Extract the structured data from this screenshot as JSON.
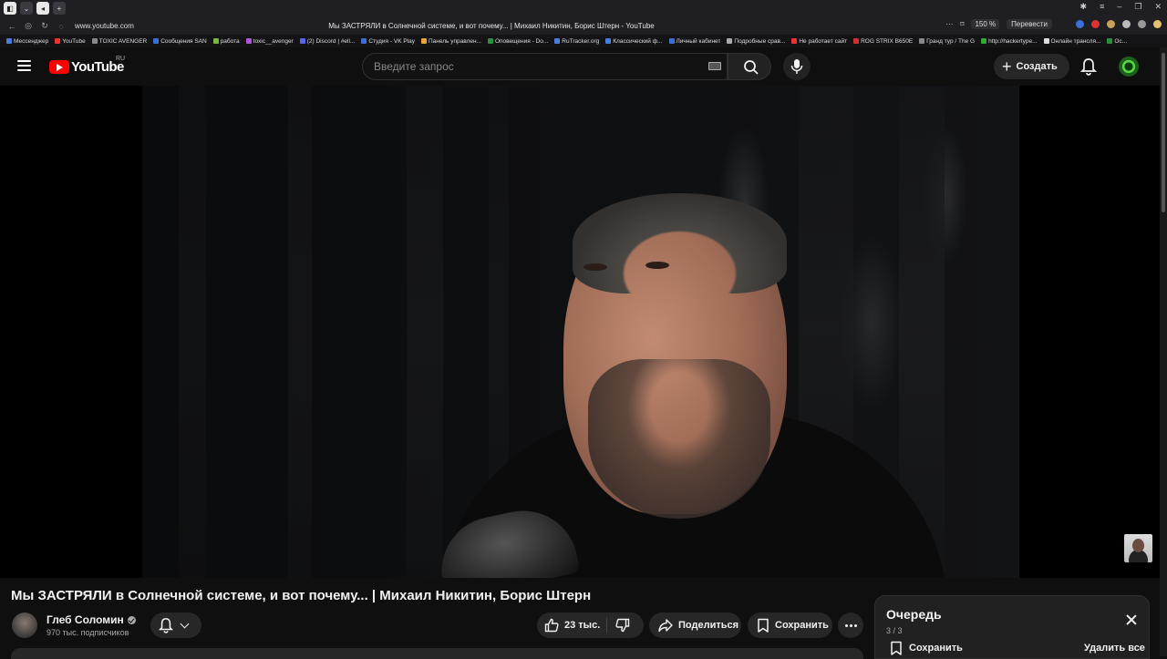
{
  "browser": {
    "page_title": "Мы ЗАСТРЯЛИ в Солнечной системе, и вот почему... | Михаил Никитин, Борис Штерн - YouTube",
    "url": "www.youtube.com",
    "zoom": "150 %",
    "translate": "Перевести",
    "bookmarks": [
      "Мессенджер",
      "YouTube",
      "TOXIC AVENGER",
      "Сообщения SAN",
      "работа",
      "toxic__avenger",
      "(2) Discord | #ell...",
      "Студия - VK Play",
      "Панель управлен...",
      "Оповещения - Do...",
      "RuTracker.org",
      "Классический ф...",
      "Личный кабинет",
      "Подробные срав...",
      "Не работает сайт",
      "ROG STRIX B650E",
      "Гранд тур / The G",
      "http://hackertype...",
      "Онлайн трансля...",
      "Ос..."
    ]
  },
  "header": {
    "logo_text": "YouTube",
    "region": "RU",
    "search_placeholder": "Введите запрос",
    "create_label": "Создать"
  },
  "video": {
    "title": "Мы ЗАСТРЯЛИ в Солнечной системе, и вот почему... | Михаил Никитин, Борис Штерн",
    "channel_name": "Глеб Соломин",
    "subscribers": "970 тыс. подписчиков",
    "likes": "23 тыс.",
    "share_label": "Поделиться",
    "save_label": "Сохранить"
  },
  "queue": {
    "title": "Очередь",
    "count": "3 / 3",
    "save_label": "Сохранить",
    "clear_label": "Удалить все"
  },
  "colors": {
    "brand_red": "#ff0000",
    "background": "#0f0f0f",
    "pill": "#272727"
  }
}
